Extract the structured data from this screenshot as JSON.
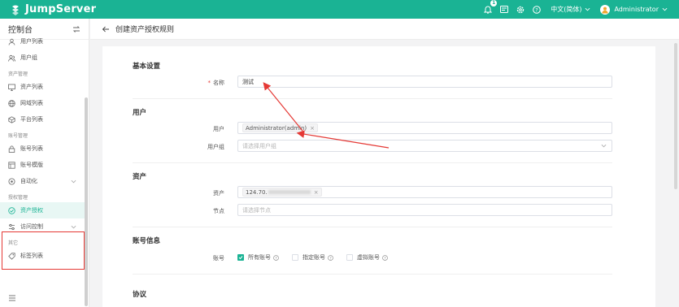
{
  "app": {
    "brand": "JumpServer"
  },
  "topbar": {
    "notification_count": "1",
    "language": "中文(简体)",
    "user": "Administrator",
    "icons": [
      "bell-icon",
      "message-icon",
      "settings-icon",
      "help-icon"
    ]
  },
  "sidebar": {
    "title": "控制台",
    "items": [
      {
        "type": "item",
        "label": "用户列表",
        "icon": "user-list-icon"
      },
      {
        "type": "item",
        "label": "用户组",
        "icon": "user-group-icon"
      },
      {
        "type": "group",
        "label": "资产管理"
      },
      {
        "type": "item",
        "label": "资产列表",
        "icon": "monitor-icon"
      },
      {
        "type": "item",
        "label": "网域列表",
        "icon": "globe-icon"
      },
      {
        "type": "item",
        "label": "平台列表",
        "icon": "platform-icon"
      },
      {
        "type": "group",
        "label": "账号管理"
      },
      {
        "type": "item",
        "label": "账号列表",
        "icon": "lock-icon"
      },
      {
        "type": "item",
        "label": "账号模版",
        "icon": "template-icon"
      },
      {
        "type": "item",
        "label": "自动化",
        "icon": "automation-icon",
        "chevron": true
      },
      {
        "type": "group",
        "label": "授权管理"
      },
      {
        "type": "item",
        "label": "资产授权",
        "icon": "check-shield-icon",
        "active": true
      },
      {
        "type": "item",
        "label": "访问控制",
        "icon": "access-control-icon",
        "chevron": true
      },
      {
        "type": "group",
        "label": "其它"
      },
      {
        "type": "item",
        "label": "标签列表",
        "icon": "tag-icon"
      }
    ]
  },
  "breadcrumb": {
    "title": "创建资产授权规则"
  },
  "form": {
    "basic": {
      "title": "基本设置",
      "name_label": "名称",
      "name_value": "测试"
    },
    "users": {
      "title": "用户",
      "user_label": "用户",
      "user_tag": "Administrator(admin)",
      "group_label": "用户组",
      "group_placeholder": "请选择用户组"
    },
    "assets": {
      "title": "资产",
      "asset_label": "资产",
      "asset_tag_prefix": "124.70.",
      "node_label": "节点",
      "node_placeholder": "请选择节点"
    },
    "accounts": {
      "title": "账号信息",
      "account_label": "账号",
      "opt_all": "所有账号",
      "opt_specified": "指定账号",
      "opt_virtual": "虚拟账号"
    },
    "protocol": {
      "title": "协议"
    }
  },
  "colors": {
    "brand": "#1ab394",
    "annotation": "#e53935"
  }
}
